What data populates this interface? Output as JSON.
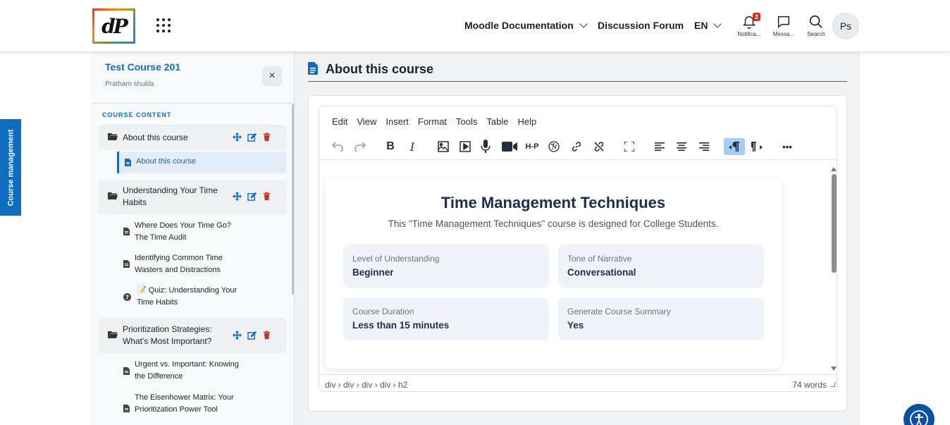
{
  "header": {
    "logo_text": "dP",
    "nav_links": [
      {
        "label": "Moodle Documentation",
        "has_dropdown": true
      },
      {
        "label": "Discussion Forum",
        "has_dropdown": false
      },
      {
        "label": "EN",
        "has_dropdown": true
      }
    ],
    "icons": [
      {
        "name": "notification-icon",
        "label": "Notifica...",
        "badge": "2"
      },
      {
        "name": "message-icon",
        "label": "Messa..."
      },
      {
        "name": "search-icon",
        "label": "Search"
      }
    ],
    "avatar_initials": "Ps"
  },
  "side_tab": {
    "label": "Course management"
  },
  "drawer": {
    "course_title": "Test Course 201",
    "author": "Pratham shukla",
    "close_icon": "×",
    "section_heading": "COURSE CONTENT",
    "sections": [
      {
        "title": "About this course",
        "activities": [
          {
            "label": "About this course",
            "icon": "page-icon",
            "active": true
          }
        ]
      },
      {
        "title": "Understanding Your Time Habits",
        "activities": [
          {
            "label": "Where Does Your Time Go? The Time Audit",
            "icon": "page-icon"
          },
          {
            "label": "Identifying Common Time Wasters and Distractions",
            "icon": "page-icon"
          },
          {
            "label": "📝 Quiz: Understanding Your Time Habits",
            "icon": "quiz-icon"
          }
        ]
      },
      {
        "title": "Prioritization Strategies: What's Most Important?",
        "activities": [
          {
            "label": "Urgent vs. Important: Knowing the Difference",
            "icon": "page-icon"
          },
          {
            "label": "The Eisenhower Matrix: Your Prioritization Power Tool",
            "icon": "page-icon"
          }
        ]
      }
    ]
  },
  "main": {
    "page_title": "About this course",
    "editor": {
      "menu": [
        "Edit",
        "View",
        "Insert",
        "Format",
        "Tools",
        "Table",
        "Help"
      ],
      "toolbar_text": {
        "bold": "B",
        "italic": "I",
        "h5p": "H-P",
        "more": "•••"
      },
      "content": {
        "title": "Time Management Techniques",
        "subtitle": "This \"Time Management Techniques\" course is designed for College Students.",
        "fields": [
          {
            "label": "Level of Understanding",
            "value": "Beginner"
          },
          {
            "label": "Tone of Narrative",
            "value": "Conversational"
          },
          {
            "label": "Course Duration",
            "value": "Less than 15 minutes"
          },
          {
            "label": "Generate Course Summary",
            "value": "Yes"
          }
        ]
      },
      "status_path": "div › div › div › div › h2",
      "word_count": "74 words"
    }
  },
  "colors": {
    "brand": "#0f6cbf",
    "badge": "#ca3120",
    "heading": "#1e2d4d"
  }
}
